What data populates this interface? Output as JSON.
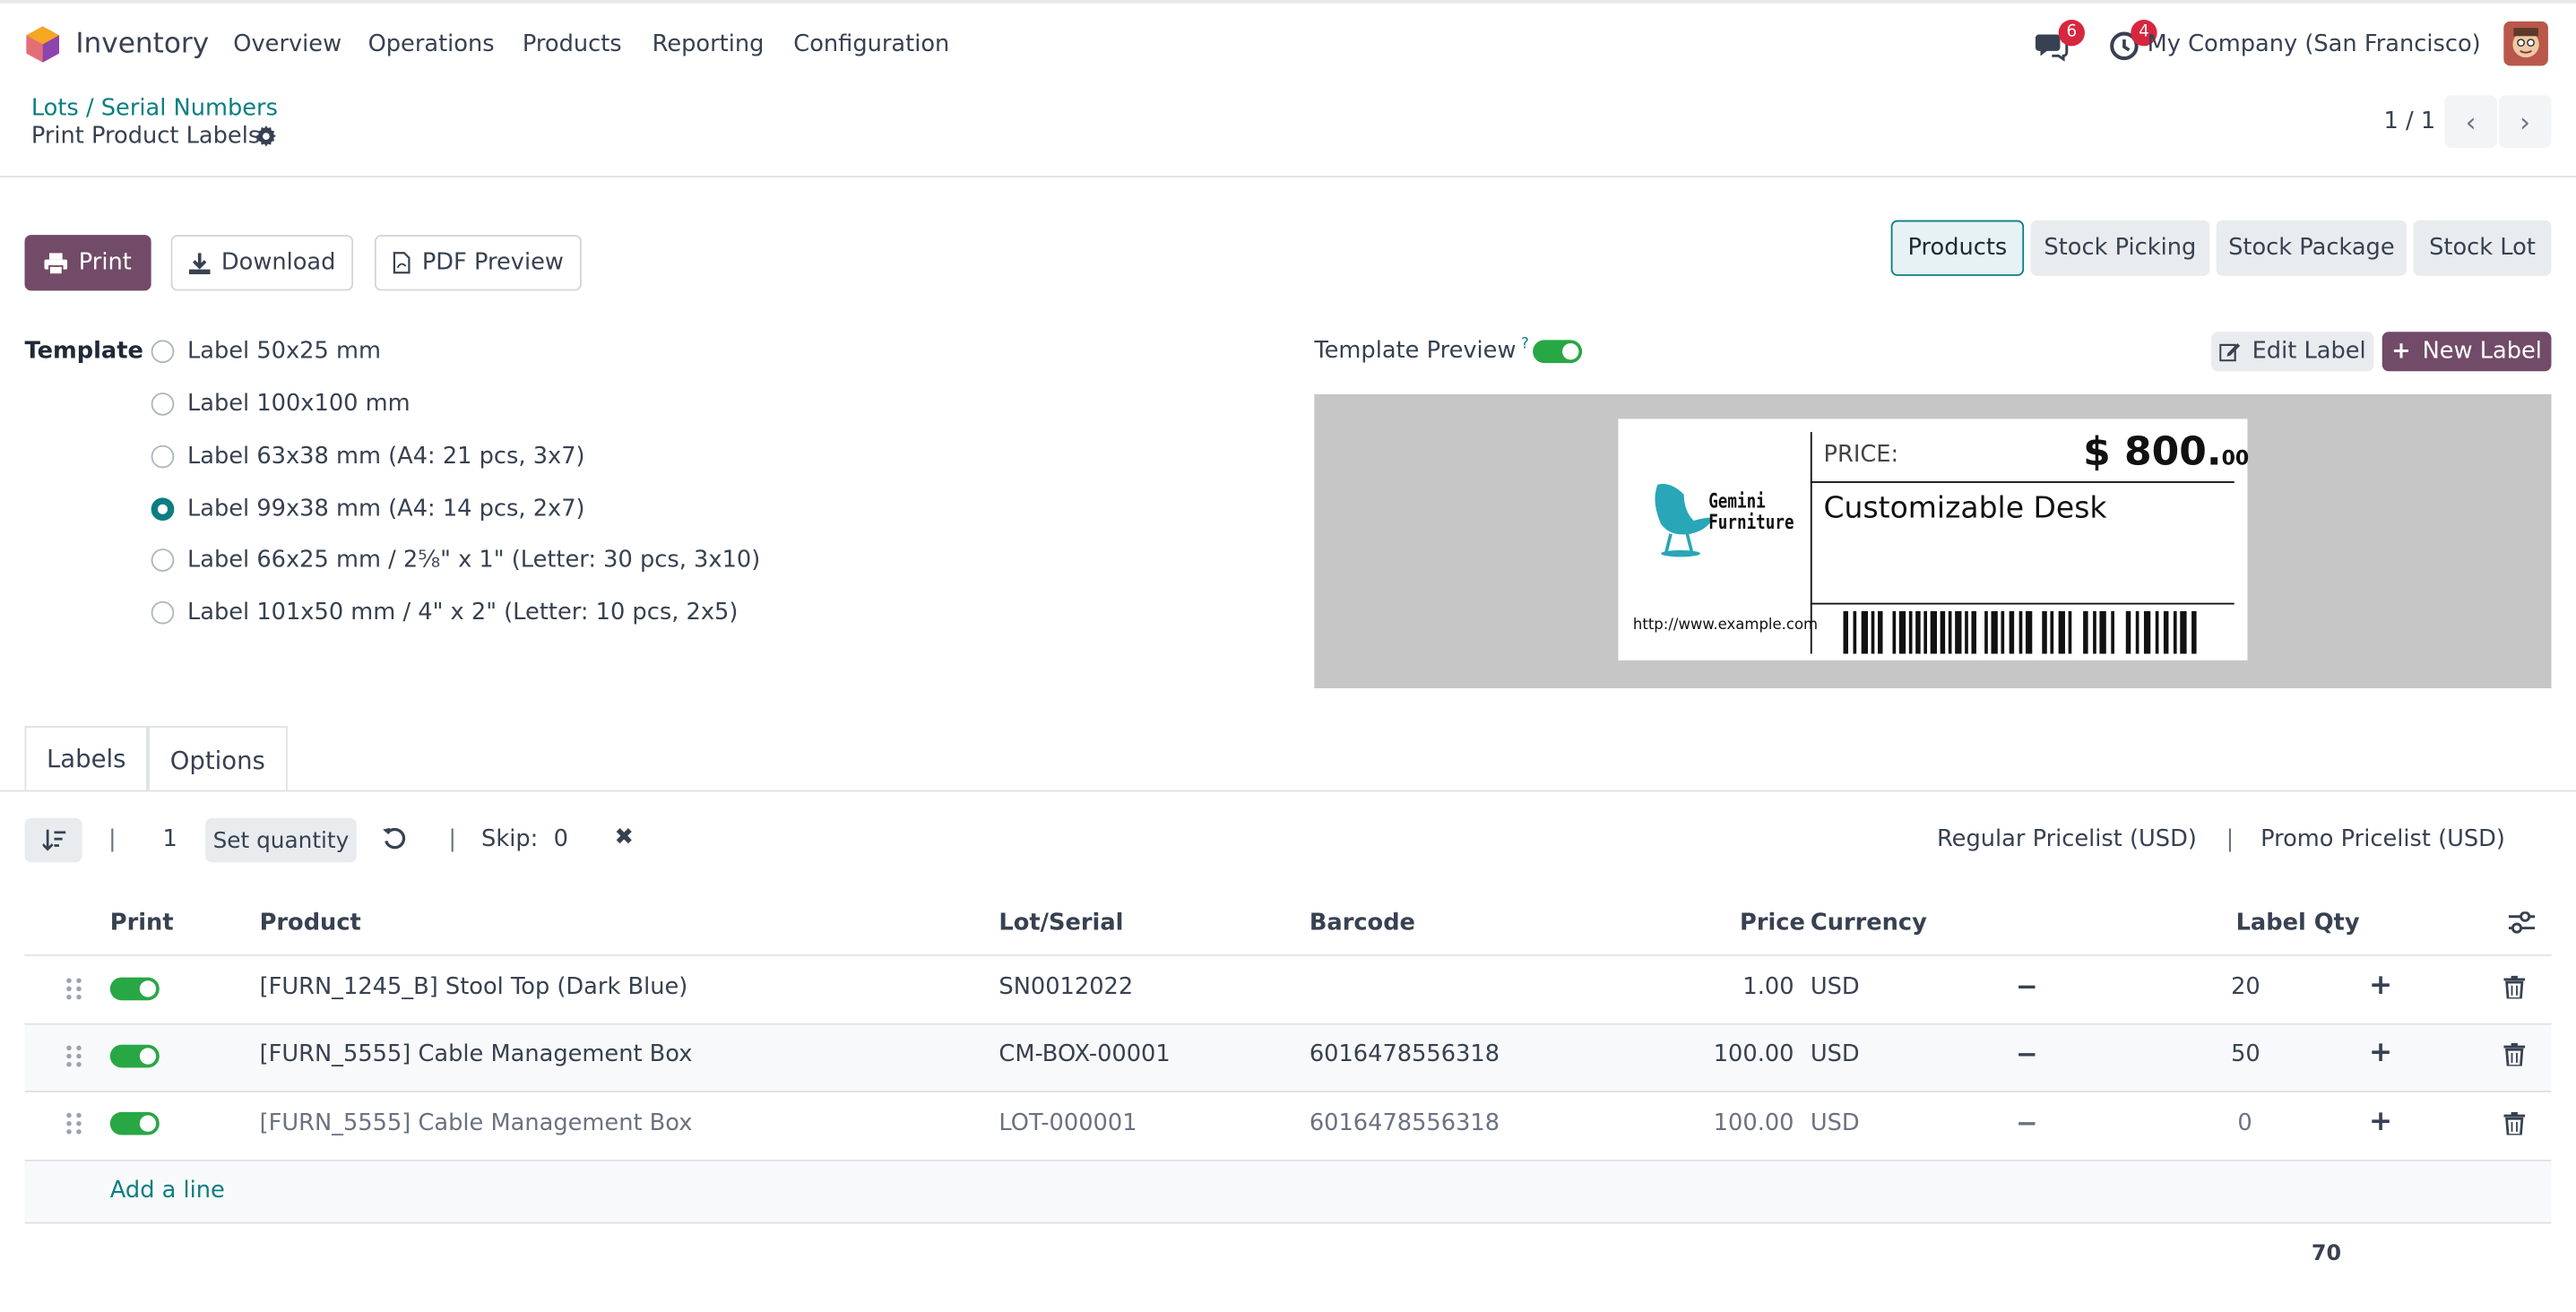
{
  "nav": {
    "app_name": "Inventory",
    "menu": [
      "Overview",
      "Operations",
      "Products",
      "Reporting",
      "Configuration"
    ],
    "messages_count": "6",
    "activities_count": "4",
    "company": "My Company (San Francisco)"
  },
  "control": {
    "breadcrumb": "Lots / Serial Numbers",
    "title": "Print Product Labels",
    "pager": "1 / 1"
  },
  "actions": {
    "print": "Print",
    "download": "Download",
    "pdf_preview": "PDF Preview"
  },
  "model_tabs": [
    "Products",
    "Stock Picking",
    "Stock Package",
    "Stock Lot"
  ],
  "template": {
    "label": "Template",
    "options": [
      "Label 50x25 mm",
      "Label 100x100 mm",
      "Label 63x38 mm (A4: 21 pcs, 3x7)",
      "Label 99x38 mm (A4: 14 pcs, 2x7)",
      "Label 66x25 mm / 2⅝\" x 1\" (Letter: 30 pcs, 3x10)",
      "Label 101x50 mm / 4\" x 2\" (Letter: 10 pcs, 2x5)"
    ],
    "selected_index": 3
  },
  "preview": {
    "label": "Template Preview",
    "help": "?",
    "enabled": true,
    "edit_label": "Edit Label",
    "new_label": "New Label",
    "card": {
      "brand_line1": "Gemini",
      "brand_line2": "Furniture",
      "price_label": "PRICE:",
      "price_currency": "$",
      "price_main": "800.",
      "price_cents": "00",
      "product_name": "Customizable Desk",
      "website": "http://www.example.com"
    }
  },
  "tabs": [
    "Labels",
    "Options"
  ],
  "toolbar": {
    "qty": "1",
    "set_quantity": "Set quantity",
    "skip_label": "Skip:",
    "skip_value": "0",
    "pricelist_regular": "Regular Pricelist (USD)",
    "pricelist_promo": "Promo Pricelist (USD)",
    "separator": "|"
  },
  "table": {
    "headers": {
      "print": "Print",
      "product": "Product",
      "lot": "Lot/Serial",
      "barcode": "Barcode",
      "price": "Price",
      "currency": "Currency",
      "label_qty": "Label Qty"
    },
    "rows": [
      {
        "product": "[FURN_1245_B] Stool Top (Dark Blue)",
        "lot": "SN0012022",
        "barcode": "",
        "price": "1.00",
        "currency": "USD",
        "qty": "20"
      },
      {
        "product": "[FURN_5555] Cable Management Box",
        "lot": "CM-BOX-00001",
        "barcode": "6016478556318",
        "price": "100.00",
        "currency": "USD",
        "qty": "50"
      },
      {
        "product": "[FURN_5555] Cable Management Box",
        "lot": "LOT-000001",
        "barcode": "6016478556318",
        "price": "100.00",
        "currency": "USD",
        "qty": "0"
      }
    ],
    "add_line": "Add a line",
    "total_qty": "70"
  }
}
